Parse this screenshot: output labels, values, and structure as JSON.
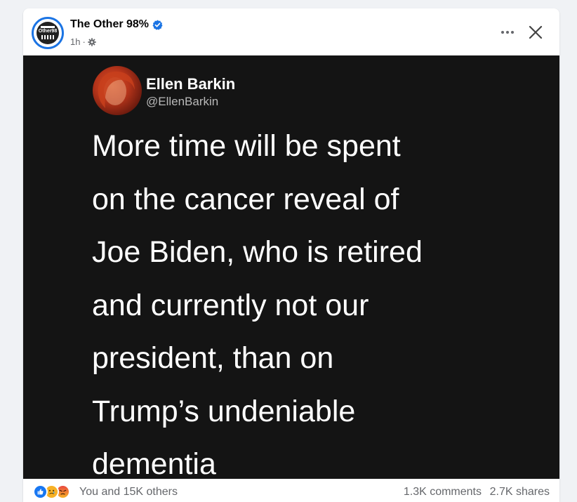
{
  "post": {
    "page_name": "The Other 98%",
    "time": "1h",
    "meta_separator": "·",
    "avatar_logo_text": "Other98",
    "colors": {
      "verified": "#1b74e4",
      "media_background": "#141414",
      "like": "#1877f2",
      "care": "#f7b125",
      "angry": "#e9710f"
    }
  },
  "icons": {
    "verified": "verified-badge-icon",
    "audience": "gear-icon",
    "more": "more-horizontal-icon",
    "close": "close-icon"
  },
  "image": {
    "tweet_author_name": "Ellen Barkin",
    "tweet_author_handle": "@EllenBarkin",
    "tweet_text": "More time will be spent\non the cancer reveal of\nJoe Biden, who is retired\nand currently not our\npresident, than on\nTrump’s undeniable\ndementia"
  },
  "footer": {
    "reactions": [
      "like",
      "care",
      "angry"
    ],
    "reaction_summary": "You and 15K others",
    "comments": "1.3K comments",
    "shares": "2.7K shares"
  }
}
